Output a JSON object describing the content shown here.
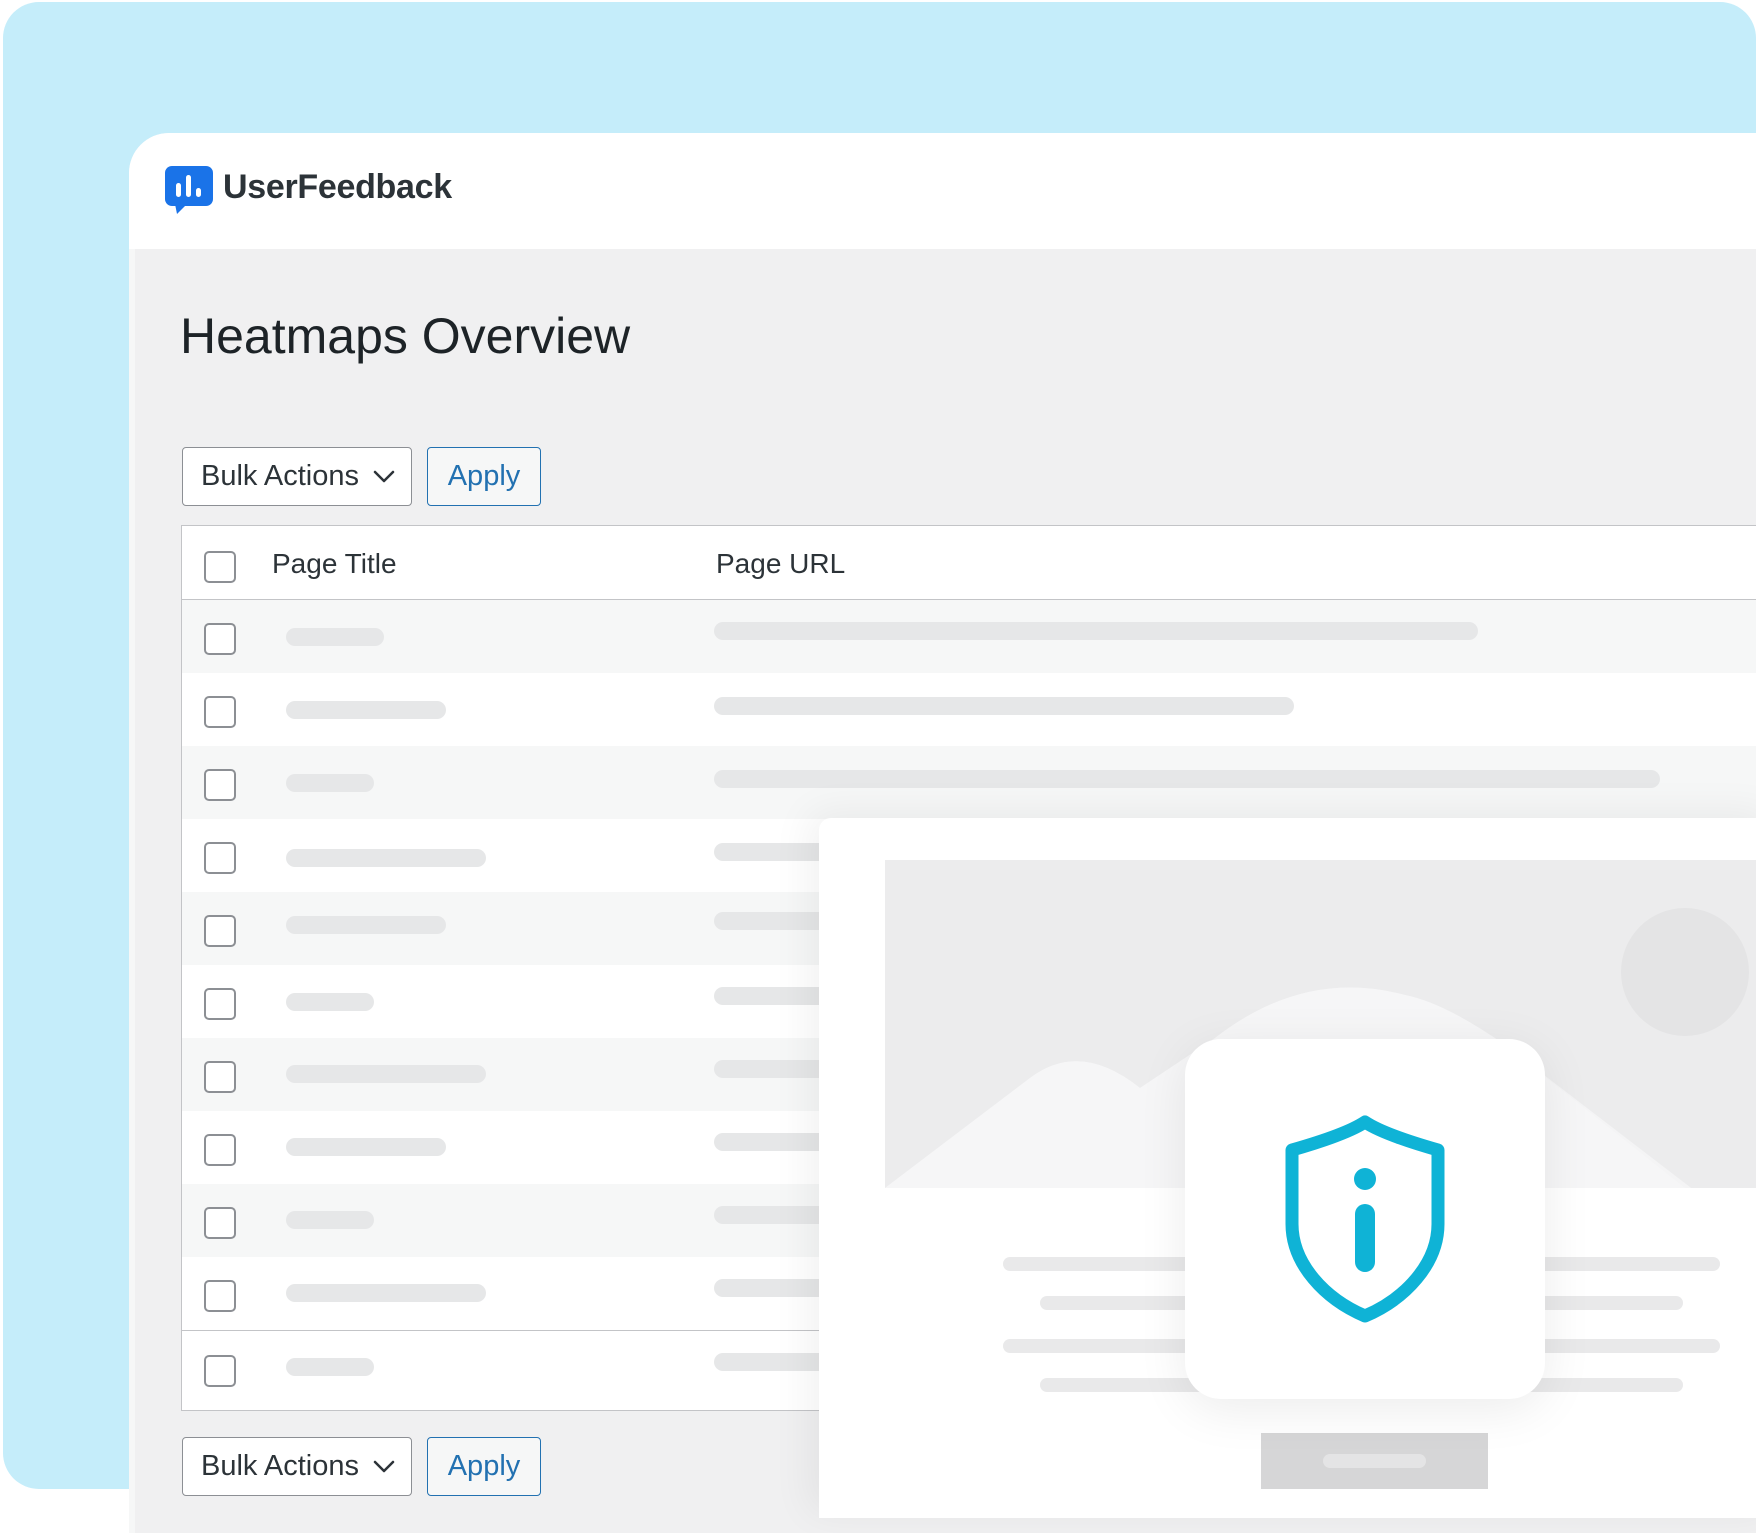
{
  "brand": {
    "name": "UserFeedback",
    "accent_color": "#1a73e8",
    "shield_color": "#0fb3d6"
  },
  "page": {
    "title": "Heatmaps Overview"
  },
  "toolbar_top": {
    "bulk_actions_label": "Bulk Actions",
    "apply_label": "Apply"
  },
  "toolbar_bottom": {
    "bulk_actions_label": "Bulk Actions",
    "apply_label": "Apply"
  },
  "table": {
    "columns": [
      "Page Title",
      "Page URL"
    ],
    "row_count": 11
  },
  "icons": {
    "logo": "userfeedback-logo-icon",
    "dropdown": "chevron-down-icon",
    "privacy": "shield-info-icon"
  }
}
